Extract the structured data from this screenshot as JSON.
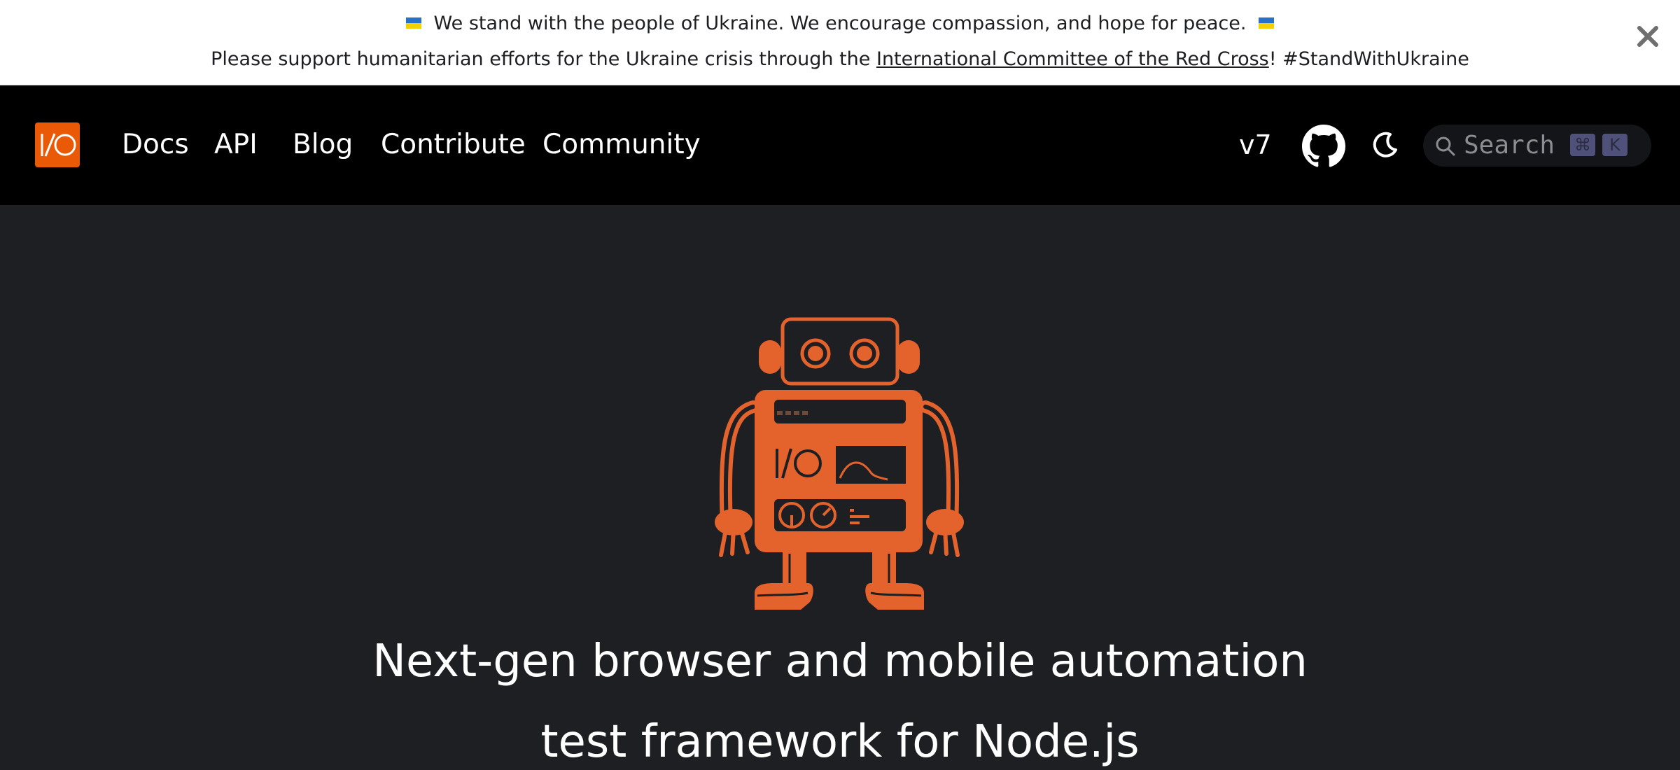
{
  "banner": {
    "line1": "We stand with the people of Ukraine. We encourage compassion, and hope for peace.",
    "line2_prefix": "Please support humanitarian efforts for the Ukraine crisis through the ",
    "line2_link": "International Committee of the Red Cross",
    "line2_suffix": "! #StandWithUkraine",
    "close_label": "✕",
    "flag_colors": [
      "#2a6fc9",
      "#f5d000"
    ]
  },
  "navbar": {
    "logo_text": "I/O",
    "links": [
      "Docs",
      "API",
      "Blog",
      "Contribute",
      "Community"
    ],
    "version": "v7",
    "github_icon": "github-icon",
    "theme_icon": "moon-icon",
    "search_placeholder": "Search",
    "search_keys": [
      "⌘",
      "K"
    ]
  },
  "hero": {
    "title_line1": "Next-gen browser and mobile automation",
    "title_line2": "test framework for Node.js",
    "accent_color": "#e4622c",
    "robot_screen_text": "I/O"
  }
}
